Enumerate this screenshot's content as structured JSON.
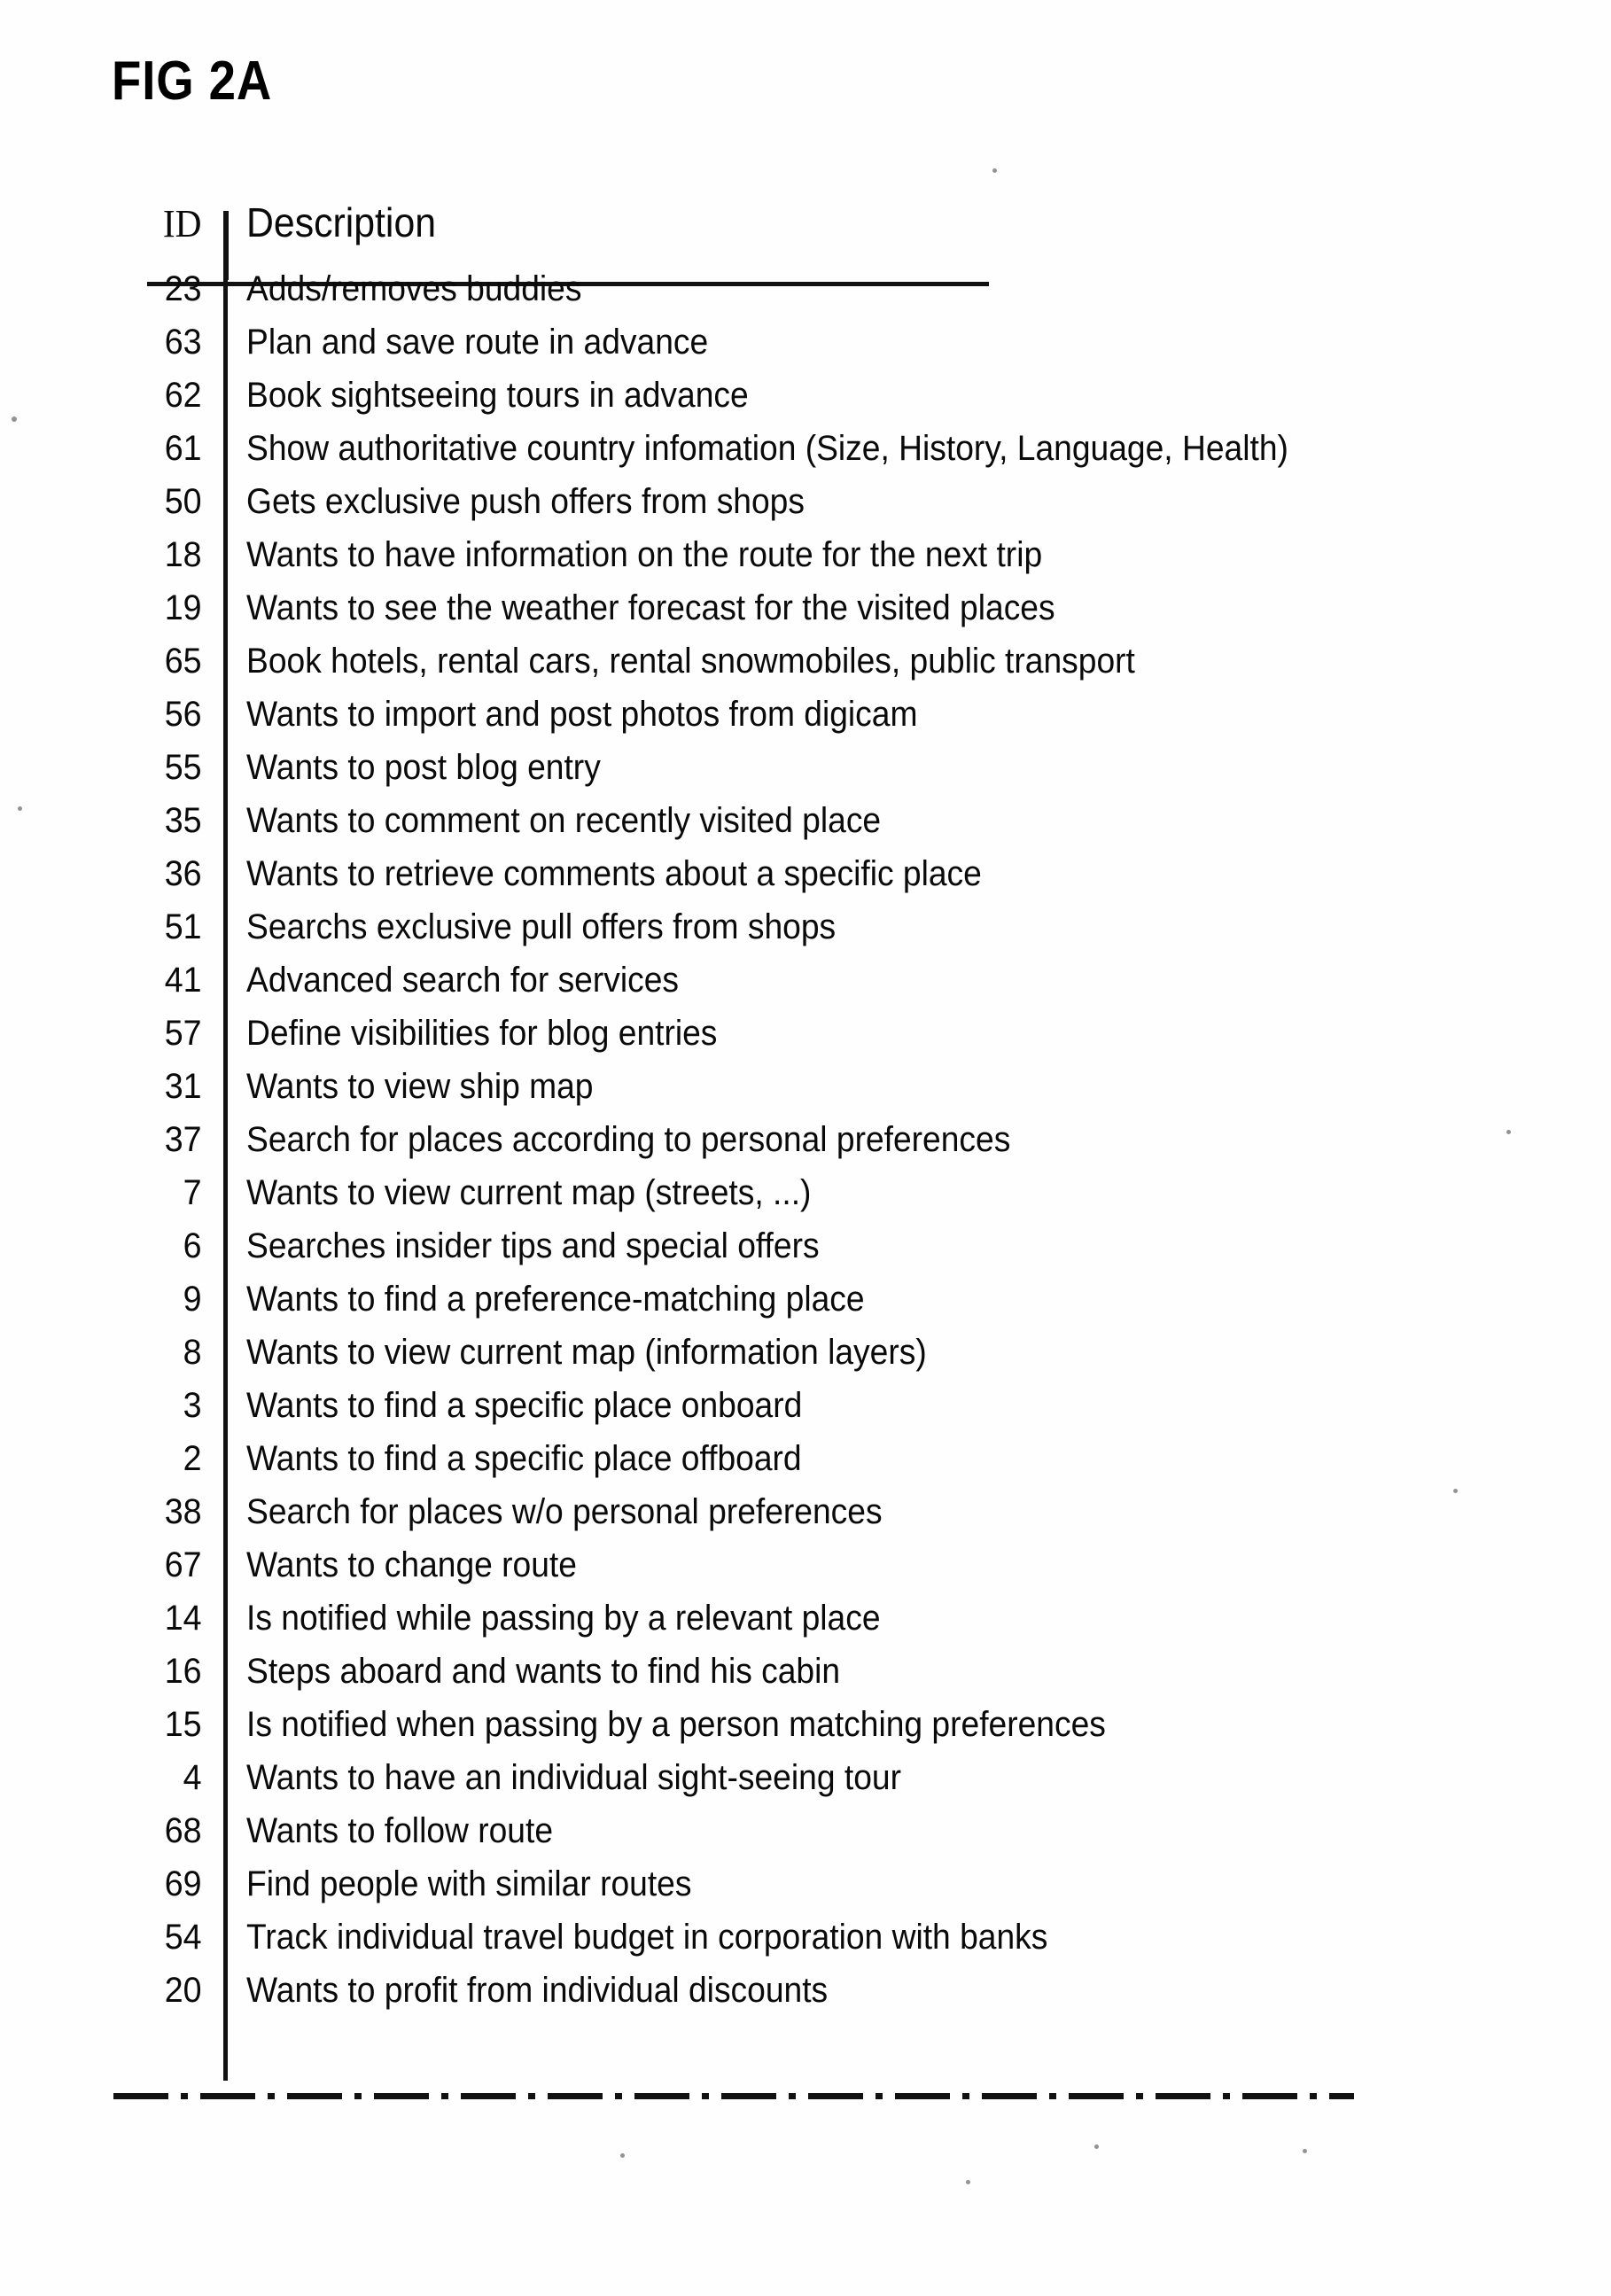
{
  "figure": {
    "title": "FIG 2A"
  },
  "table": {
    "columns": {
      "id": "ID",
      "description": "Description"
    },
    "rows": [
      {
        "id": "23",
        "description": "Adds/removes buddies"
      },
      {
        "id": "63",
        "description": "Plan and save route in advance"
      },
      {
        "id": "62",
        "description": "Book sightseeing tours in advance"
      },
      {
        "id": "61",
        "description": "Show authoritative country infomation (Size, History, Language, Health)"
      },
      {
        "id": "50",
        "description": "Gets exclusive push offers from shops"
      },
      {
        "id": "18",
        "description": "Wants to have information on the route for the next trip"
      },
      {
        "id": "19",
        "description": "Wants to see the weather forecast for the visited places"
      },
      {
        "id": "65",
        "description": "Book hotels, rental cars, rental snowmobiles, public transport"
      },
      {
        "id": "56",
        "description": "Wants to import and post photos from digicam"
      },
      {
        "id": "55",
        "description": "Wants to post blog entry"
      },
      {
        "id": "35",
        "description": "Wants to comment on recently visited place"
      },
      {
        "id": "36",
        "description": "Wants to retrieve comments about a specific place"
      },
      {
        "id": "51",
        "description": "Searchs exclusive pull offers from shops"
      },
      {
        "id": "41",
        "description": "Advanced search for services"
      },
      {
        "id": "57",
        "description": "Define visibilities for blog entries"
      },
      {
        "id": "31",
        "description": "Wants to view ship map"
      },
      {
        "id": "37",
        "description": "Search for places according to personal preferences"
      },
      {
        "id": "7",
        "description": "Wants to view current map (streets, ...)"
      },
      {
        "id": "6",
        "description": "Searches insider tips and special offers"
      },
      {
        "id": "9",
        "description": "Wants to find a preference-matching place"
      },
      {
        "id": "8",
        "description": "Wants to view current map (information layers)"
      },
      {
        "id": "3",
        "description": "Wants to find a specific place onboard"
      },
      {
        "id": "2",
        "description": "Wants to find a specific place offboard"
      },
      {
        "id": "38",
        "description": "Search for places w/o personal preferences"
      },
      {
        "id": "67",
        "description": "Wants to change route"
      },
      {
        "id": "14",
        "description": "Is notified while passing by a relevant place"
      },
      {
        "id": "16",
        "description": "Steps aboard and wants to find his cabin"
      },
      {
        "id": "15",
        "description": "Is notified when passing by a person matching preferences"
      },
      {
        "id": "4",
        "description": "Wants to have an individual sight-seeing tour"
      },
      {
        "id": "68",
        "description": "Wants to follow route"
      },
      {
        "id": "69",
        "description": "Find people with similar routes"
      },
      {
        "id": "54",
        "description": "Track individual travel budget in corporation with banks"
      },
      {
        "id": "20",
        "description": "Wants to profit from individual discounts"
      }
    ]
  }
}
